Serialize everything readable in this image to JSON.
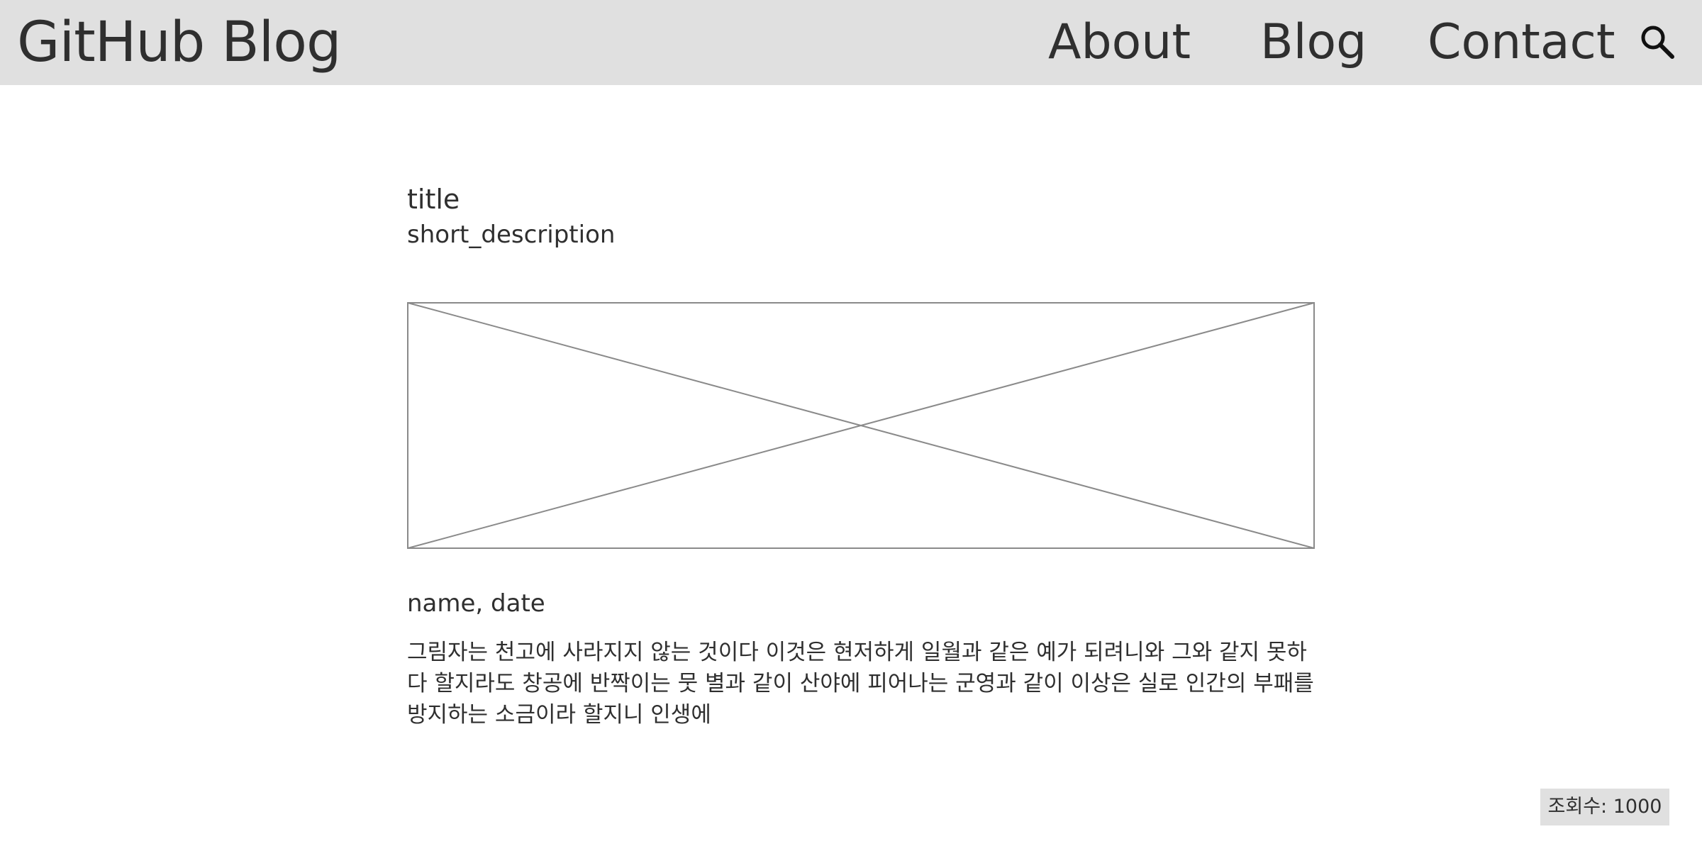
{
  "header": {
    "brand": "GitHub Blog",
    "nav": {
      "about": "About",
      "blog": "Blog",
      "contact": "Contact"
    },
    "search_icon": "search-icon"
  },
  "post": {
    "title": "title",
    "subtitle": "short_description",
    "image_placeholder_icon": "image-placeholder",
    "meta": "name, date",
    "body": "그림자는 천고에 사라지지 않는 것이다 이것은 현저하게 일월과 같은 예가 되려니와 그와 같지 못하다 할지라도 창공에 반짝이는 뭇 별과 같이 산야에 피어나는 군영과 같이 이상은 실로 인간의 부패를 방지하는 소금이라 할지니 인생에"
  },
  "footer": {
    "view_count": "조회수: 1000"
  },
  "colors": {
    "header_bg": "#e0e0e0",
    "text": "#2f2f2f",
    "placeholder_stroke": "#8a8a8a",
    "counter_bg": "#e0e0e0"
  }
}
